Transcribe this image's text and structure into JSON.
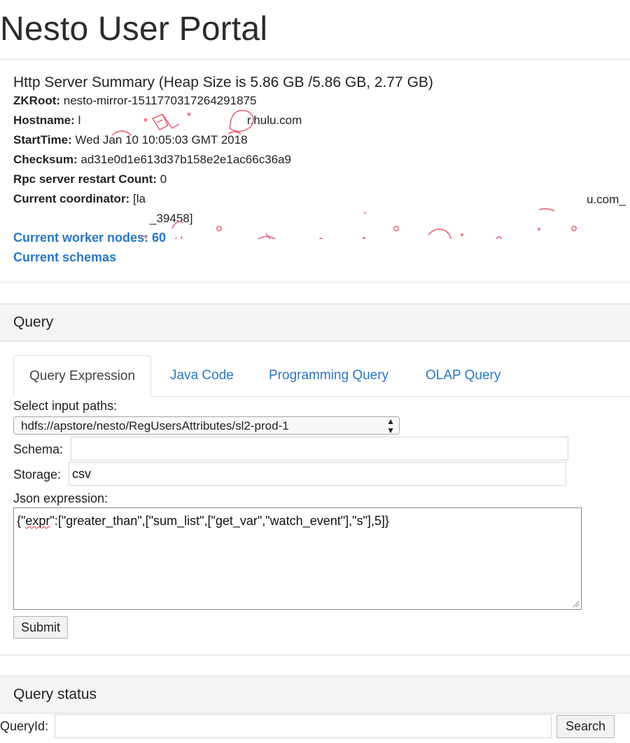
{
  "page": {
    "title": "Nesto User Portal"
  },
  "summary": {
    "title": "Http Server Summary (Heap Size is 5.86 GB /5.86 GB, 2.77 GB)",
    "zkroot": {
      "label": "ZKRoot:",
      "value": "nesto-mirror-1511770317264291875"
    },
    "hostname": {
      "label": "Hostname:",
      "value_start": "l",
      "value_end": "r.hulu.com"
    },
    "starttime": {
      "label": "StartTime:",
      "value": "Wed Jan 10 10:05:03 GMT 2018"
    },
    "checksum": {
      "label": "Checksum:",
      "value": "ad31e0d1e613d37b158e2e1ac66c36a9"
    },
    "rpc_restart": {
      "label": "Rpc server restart Count:",
      "value": "0"
    },
    "coordinator": {
      "label": "Current coordinator:",
      "value_start": "[la",
      "value_end": "u.com_",
      "value_line2": "_39458]"
    },
    "worker_nodes_link": "Current worker nodes: 60",
    "schemas_link": "Current schemas"
  },
  "query_panel": {
    "heading": "Query",
    "tabs": [
      {
        "label": "Query Expression",
        "active": true
      },
      {
        "label": "Java Code",
        "active": false
      },
      {
        "label": "Programming Query",
        "active": false
      },
      {
        "label": "OLAP Query",
        "active": false
      }
    ],
    "input_paths_label": "Select input paths:",
    "input_path_selected": "hdfs://apstore/nesto/RegUsersAttributes/sl2-prod-1",
    "schema_label": "Schema:",
    "schema_value": "",
    "storage_label": "Storage:",
    "storage_value": "csv",
    "json_label": "Json expression:",
    "json_prefix": "{\"",
    "json_key": "expr",
    "json_rest": "\":[\"greater_than\",[\"sum_list\",[\"get_var\",\"watch_event\"],\"s\"],5]}",
    "submit_label": "Submit"
  },
  "status_panel": {
    "heading": "Query status",
    "query_id_label": "QueryId:",
    "query_id_value": "",
    "search_label": "Search"
  },
  "colors": {
    "link": "#2a76c6",
    "redaction": "#e8556a"
  }
}
